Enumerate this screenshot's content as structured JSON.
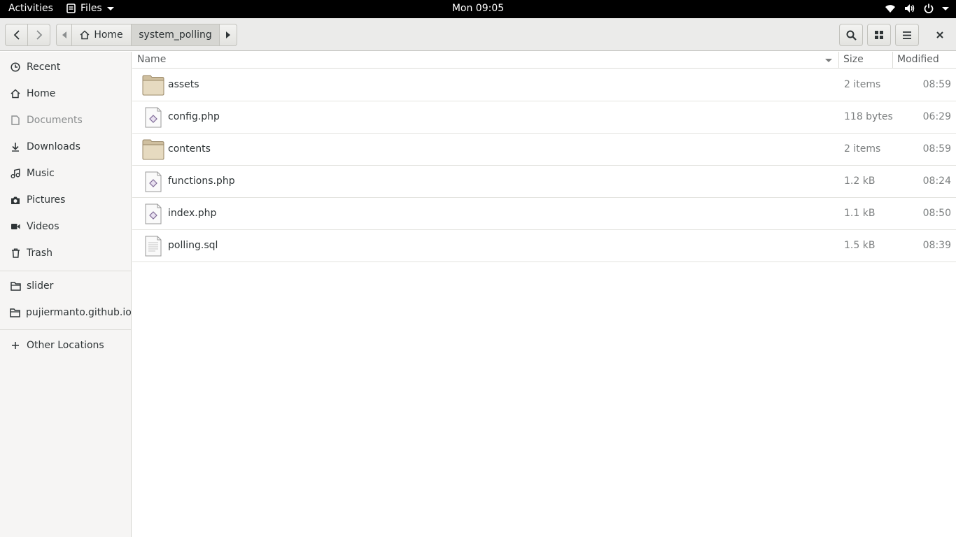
{
  "topbar": {
    "activities": "Activities",
    "app_name": "Files",
    "clock": "Mon 09:05",
    "tray_icons": [
      "wifi-icon",
      "volume-icon",
      "power-icon"
    ]
  },
  "header": {
    "crumb_home": "Home",
    "crumb_current": "system_polling"
  },
  "sidebar": {
    "items": [
      {
        "label": "Recent",
        "icon": "clock-icon"
      },
      {
        "label": "Home",
        "icon": "home-icon"
      },
      {
        "label": "Documents",
        "icon": "document-icon"
      },
      {
        "label": "Downloads",
        "icon": "download-icon"
      },
      {
        "label": "Music",
        "icon": "music-icon"
      },
      {
        "label": "Pictures",
        "icon": "camera-icon"
      },
      {
        "label": "Videos",
        "icon": "video-icon"
      },
      {
        "label": "Trash",
        "icon": "trash-icon"
      }
    ],
    "bookmarks": [
      {
        "label": "slider",
        "icon": "folder-icon"
      },
      {
        "label": "pujiermanto.github.io",
        "icon": "folder-icon"
      }
    ],
    "other_locations": "Other Locations"
  },
  "columns": {
    "name": "Name",
    "size": "Size",
    "modified": "Modified"
  },
  "files": [
    {
      "name": "assets",
      "type": "folder",
      "size": "2 items",
      "modified": "08:59"
    },
    {
      "name": "config.php",
      "type": "php",
      "size": "118 bytes",
      "modified": "06:29"
    },
    {
      "name": "contents",
      "type": "folder",
      "size": "2 items",
      "modified": "08:59"
    },
    {
      "name": "functions.php",
      "type": "php",
      "size": "1.2 kB",
      "modified": "08:24"
    },
    {
      "name": "index.php",
      "type": "php",
      "size": "1.1 kB",
      "modified": "08:50"
    },
    {
      "name": "polling.sql",
      "type": "text",
      "size": "1.5 kB",
      "modified": "08:39"
    }
  ]
}
